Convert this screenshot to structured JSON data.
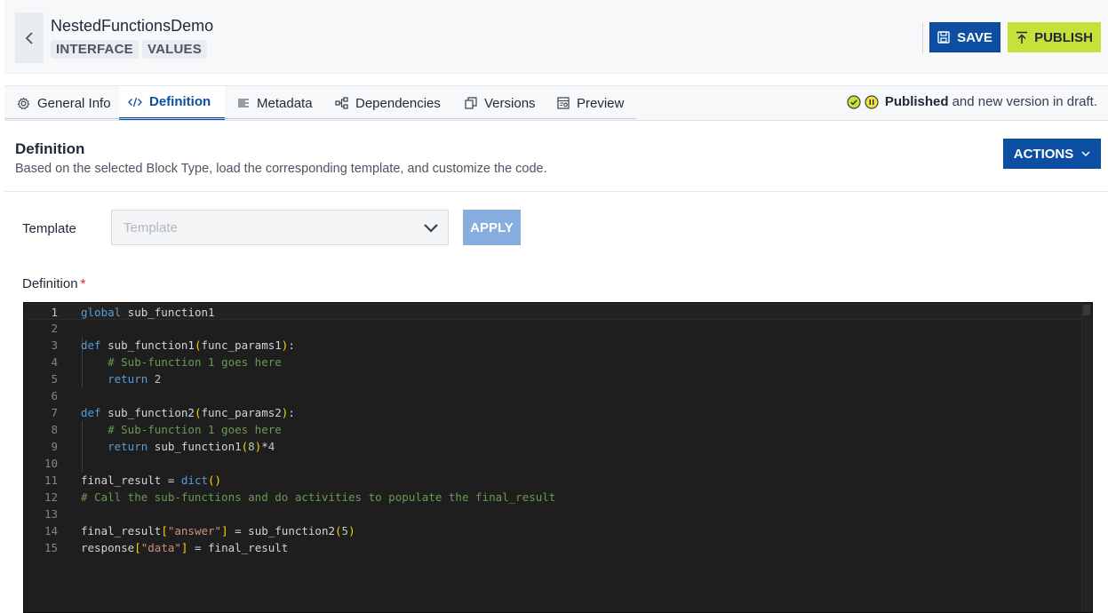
{
  "header": {
    "title": "NestedFunctionsDemo",
    "tags": [
      "INTERFACE",
      "VALUES"
    ],
    "save_label": "SAVE",
    "publish_label": "PUBLISH"
  },
  "tabs": [
    {
      "label": "General Info",
      "icon": "gear-icon",
      "active": false
    },
    {
      "label": "Definition",
      "icon": "code-icon",
      "active": true
    },
    {
      "label": "Metadata",
      "icon": "list-icon",
      "active": false
    },
    {
      "label": "Dependencies",
      "icon": "tree-icon",
      "active": false
    },
    {
      "label": "Versions",
      "icon": "copy-icon",
      "active": false
    },
    {
      "label": "Preview",
      "icon": "preview-icon",
      "active": false
    }
  ],
  "status": {
    "strong": "Published",
    "rest": "and new version in draft."
  },
  "section": {
    "title": "Definition",
    "subtitle": "Based on the selected Block Type, load the corresponding template, and customize the code.",
    "actions_label": "ACTIONS"
  },
  "template": {
    "label": "Template",
    "placeholder": "Template",
    "apply_label": "APPLY"
  },
  "definition": {
    "label": "Definition",
    "required_mark": "*"
  },
  "code_lines": [
    "global sub_function1",
    "",
    "def sub_function1(func_params1):",
    "    # Sub-function 1 goes here",
    "    return 2",
    "",
    "def sub_function2(func_params2):",
    "    # Sub-function 1 goes here",
    "    return sub_function1(8)*4",
    "",
    "final_result = dict()",
    "# Call the sub-functions and do activities to populate the final_result",
    "",
    "final_result[\"answer\"] = sub_function2(5)",
    "response[\"data\"] = final_result"
  ],
  "colors": {
    "primary": "#0b4ea2",
    "publish": "#c7e03a",
    "apply_disabled": "#87aede",
    "editor_bg": "#1e1e1e"
  }
}
